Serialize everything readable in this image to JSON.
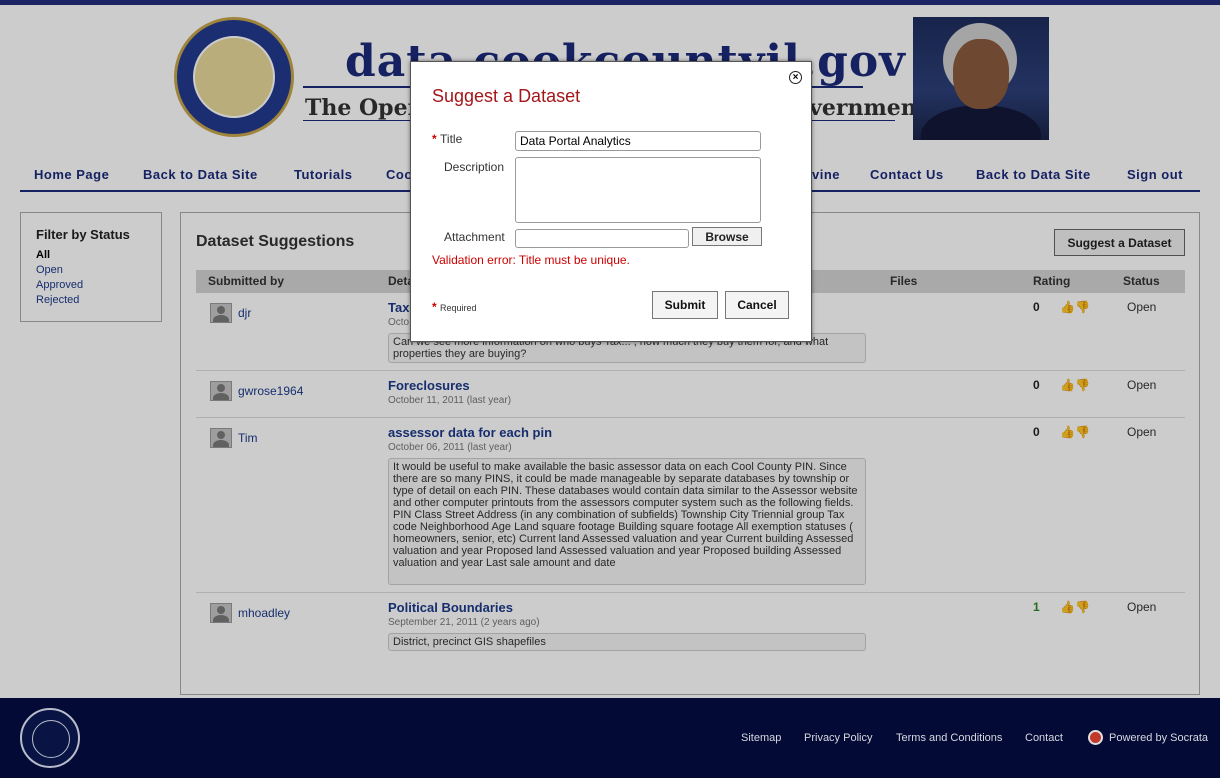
{
  "header": {
    "site_title": "data.cookcountyil.gov",
    "subtitle": "The Open Data Portal of Cook County Government"
  },
  "nav": {
    "items": [
      "Home Page",
      "Back to Data Site",
      "Tutorials",
      "Coo",
      "vine",
      "Contact Us",
      "Back to Data Site",
      "Sign out"
    ]
  },
  "sidebar": {
    "title": "Filter by Status",
    "items": [
      "All",
      "Open",
      "Approved",
      "Rejected"
    ]
  },
  "main": {
    "title": "Dataset Suggestions",
    "suggest_button": "Suggest a Dataset",
    "columns": [
      "Submitted by",
      "Deta",
      "Files",
      "Rating",
      "Status"
    ],
    "rows": [
      {
        "user": "djr",
        "title": "Tax",
        "date": "Octo",
        "description": "Can we see more information on who buys Tax... , how much they buy them for, and what properties they are buying?",
        "rating": "0",
        "status": "Open"
      },
      {
        "user": "gwrose1964",
        "title": "Foreclosures",
        "date": "October 11, 2011 (last year)",
        "description": "",
        "rating": "0",
        "status": "Open"
      },
      {
        "user": "Tim",
        "title": "assessor data for each pin",
        "date": "October 06, 2011 (last year)",
        "description": "It would be useful to make available the basic assessor data on each Cool County PIN. Since there are so many PINS, it could be made manageable by separate databases by township or type of detail on each PIN. These databases would contain data similar to the Assessor website and other computer printouts from the assessors computer system such as the following fields. PIN Class Street Address (in any combination of subfields) Township City Triennial group Tax code Neighborhood Age Land square footage Building square footage All exemption statuses ( homeowners, senior, etc) Current land Assessed valuation and year Current building Assessed valuation and year Proposed land Assessed valuation and year Proposed building Assessed valuation and year Last sale amount and date",
        "rating": "0",
        "status": "Open"
      },
      {
        "user": "mhoadley",
        "title": "Political Boundaries",
        "date": "September 21, 2011 (2 years ago)",
        "description": "District, precinct GIS shapefiles",
        "rating": "1",
        "status": "Open"
      }
    ]
  },
  "modal": {
    "title": "Suggest a Dataset",
    "close_icon": "close-icon",
    "title_label": "Title",
    "title_value": "Data Portal Analytics",
    "description_label": "Description",
    "description_value": "",
    "attachment_label": "Attachment",
    "attachment_value": "",
    "browse_button": "Browse",
    "validation_error": "Validation error: Title must be unique.",
    "required_note": "Required",
    "submit_button": "Submit",
    "cancel_button": "Cancel"
  },
  "footer": {
    "links": [
      "Sitemap",
      "Privacy Policy",
      "Terms and Conditions",
      "Contact",
      "Powered by Socrata"
    ]
  },
  "colors": {
    "brand_navy": "#1c2a7a",
    "footer_bg": "#020a35",
    "modal_title": "#a4161a",
    "error": "#cc0000"
  }
}
